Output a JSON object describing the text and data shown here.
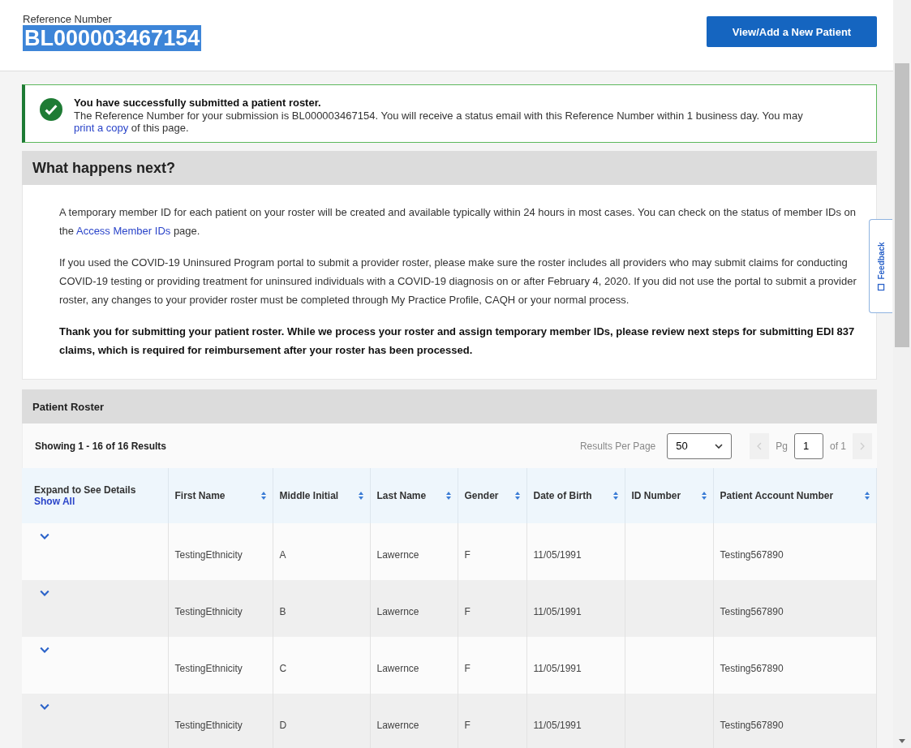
{
  "header": {
    "reference_label": "Reference Number",
    "reference_number": "BL000003467154",
    "reference_selected": true,
    "new_patient_button": "View/Add a New Patient"
  },
  "alert": {
    "title": "You have successfully submitted a patient roster.",
    "text_before": "The Reference Number for your submission is BL000003467154. You will receive a status email with this Reference Number within 1 business day. You may ",
    "link": "print a copy",
    "text_after": " of this page."
  },
  "next_steps": {
    "title": "What happens next?",
    "paragraphs": [
      {
        "kind": "link",
        "before": "A temporary member ID for each patient on your roster will be created and available typically within 24 hours in most cases. You can check on the status of member IDs on the ",
        "link": "Access Member IDs",
        "after": " page."
      },
      {
        "kind": "plain",
        "text": "If you used the COVID-19 Uninsured Program portal to submit a provider roster, please make sure the roster includes all providers who may submit claims for conducting COVID-19 testing or providing treatment for uninsured individuals with a COVID-19 diagnosis on or after February 4, 2020. If you did not use the portal to submit a provider roster, any changes to your provider roster must be completed through My Practice Profile, CAQH or your normal process."
      },
      {
        "kind": "bold",
        "text": "Thank you for submitting your patient roster. While we process your roster and assign temporary member IDs, please review next steps for submitting EDI 837 claims, which is required for reimbursement after your roster has been processed."
      }
    ]
  },
  "feedback_tab": "Feedback",
  "roster": {
    "title": "Patient Roster",
    "showing": "Showing 1 - 16 of 16 Results",
    "per_page_label": "Results Per Page",
    "per_page": "50",
    "page_label": "Pg",
    "page": "1",
    "page_of": "of 1",
    "expand_header": "Expand to See Details",
    "show_all": "Show All",
    "columns": [
      "First Name",
      "Middle Initial",
      "Last Name",
      "Gender",
      "Date of Birth",
      "ID Number",
      "Patient Account Number"
    ],
    "rows": [
      {
        "expanded": false,
        "cells": [
          "TestingEthnicity",
          "A",
          "Lawernce",
          "F",
          "11/05/1991",
          "",
          "Testing567890"
        ]
      },
      {
        "expanded": false,
        "cells": [
          "TestingEthnicity",
          "B",
          "Lawernce",
          "F",
          "11/05/1991",
          "",
          "Testing567890"
        ]
      },
      {
        "expanded": false,
        "cells": [
          "TestingEthnicity",
          "C",
          "Lawernce",
          "F",
          "11/05/1991",
          "",
          "Testing567890"
        ]
      },
      {
        "expanded": false,
        "cells": [
          "TestingEthnicity",
          "D",
          "Lawernce",
          "F",
          "11/05/1991",
          "",
          "Testing567890"
        ]
      }
    ]
  }
}
